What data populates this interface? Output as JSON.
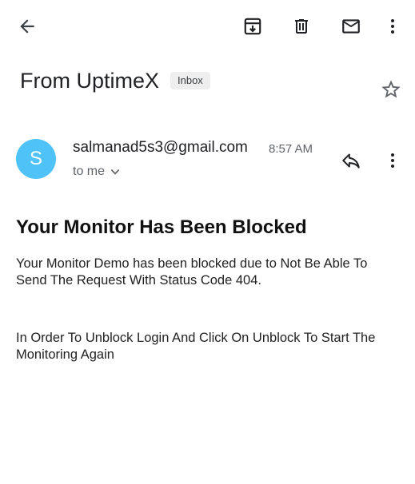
{
  "toolbar": {
    "back_icon": "arrow-left-icon",
    "archive_icon": "archive-icon",
    "delete_icon": "trash-icon",
    "mark_unread_icon": "mail-icon",
    "more_icon": "more-vert-icon"
  },
  "email": {
    "subject": "From UptimeX",
    "label": "Inbox",
    "star_icon": "star-outline-icon",
    "sender": {
      "avatar_letter": "S",
      "avatar_color": "#4fc3f7",
      "address": "salmanad5s3@gmail.com",
      "time": "8:57 AM",
      "recipient": "to me"
    },
    "reply_icon": "reply-icon",
    "body": {
      "headline": "Your Monitor Has Been Blocked",
      "paragraph1": "Your Monitor Demo has been blocked due to Not Be Able To Send The Request With Status Code 404.",
      "paragraph2": "In Order To Unblock Login And Click On Unblock To Start The Monitoring Again"
    }
  }
}
